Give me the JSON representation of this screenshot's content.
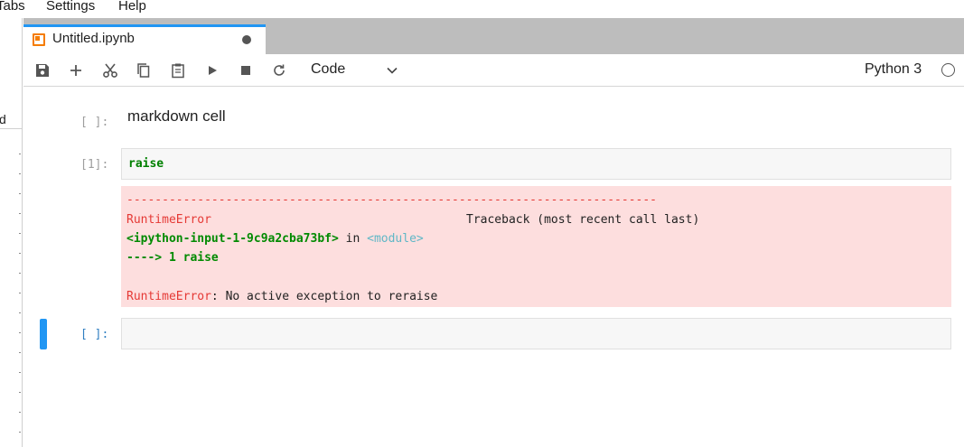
{
  "menubar": {
    "items": [
      "Tabs",
      "Settings",
      "Help"
    ]
  },
  "sidebar": {
    "label": "d"
  },
  "tab": {
    "title": "Untitled.ipynb",
    "icon": "notebook-icon",
    "dirty": true
  },
  "toolbar": {
    "buttons": [
      "save-icon",
      "add-icon",
      "cut-icon",
      "copy-icon",
      "paste-icon",
      "run-icon",
      "stop-icon",
      "restart-icon"
    ],
    "cell_type": "Code",
    "kernel": "Python 3"
  },
  "cells": {
    "markdown": {
      "prompt": "[ ]:",
      "text": "markdown cell"
    },
    "code1": {
      "prompt": "[1]:",
      "source": "raise"
    },
    "error": {
      "rule": "---------------------------------------------------------------------------",
      "err_name": "RuntimeError",
      "traceback_label": "Traceback (most recent call last)",
      "input_ref": "<ipython-input-1-9c9a2cba73bf>",
      "in_word": " in ",
      "module": "<module>",
      "arrow_line": "----> 1 raise",
      "err_name2": "RuntimeError",
      "err_msg": ": No active exception to reraise"
    },
    "empty": {
      "prompt": "[ ]:"
    }
  },
  "colors": {
    "accent": "#2196f3",
    "error_bg": "#fddede",
    "error_red": "#e53935",
    "code_green": "#008000"
  }
}
